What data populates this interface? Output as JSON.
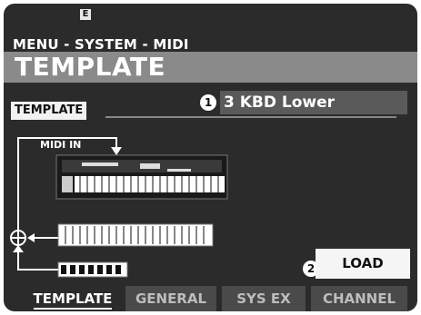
{
  "status": {
    "indicator": "E"
  },
  "header": {
    "breadcrumb": "MENU - SYSTEM - MIDI",
    "title": "TEMPLATE"
  },
  "template": {
    "label": "TEMPLATE",
    "value": "3 KBD Lower",
    "value_marker": "1"
  },
  "diagram": {
    "midi_in_label": "MIDI IN"
  },
  "load": {
    "label": "LOAD",
    "marker": "2"
  },
  "tabs": [
    {
      "label": "TEMPLATE",
      "active": true
    },
    {
      "label": "GENERAL",
      "active": false
    },
    {
      "label": "SYS EX",
      "active": false
    },
    {
      "label": "CHANNEL",
      "active": false
    }
  ]
}
